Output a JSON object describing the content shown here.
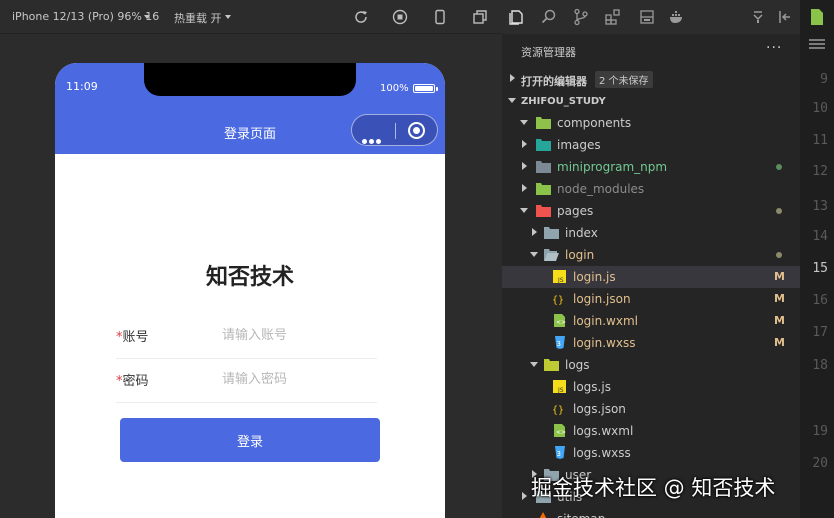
{
  "simulator": {
    "device_label": "iPhone 12/13 (Pro) 96% 16",
    "hot_reload_label": "热重载 开",
    "status": {
      "time": "11:09",
      "battery": "100%"
    },
    "nav_title": "登录页面",
    "page": {
      "heading": "知否技术",
      "username": {
        "required_mark": "*",
        "label": "账号",
        "placeholder": "请输入账号"
      },
      "password": {
        "required_mark": "*",
        "label": "密码",
        "placeholder": "请输入密码"
      },
      "login_button": "登录"
    },
    "colors": {
      "brand": "#4b69e0",
      "required": "#e03b3b"
    }
  },
  "explorer": {
    "title": "资源管理器",
    "more": "···",
    "open_editors": {
      "label": "打开的编辑器",
      "badge": "2 个未保存"
    },
    "project": "ZHIFOU_STUDY",
    "items": [
      {
        "label": "components",
        "status": ""
      },
      {
        "label": "images",
        "status": ""
      },
      {
        "label": "miniprogram_npm",
        "status": ""
      },
      {
        "label": "node_modules",
        "status": ""
      },
      {
        "label": "pages",
        "status": ""
      },
      {
        "label": "index",
        "status": ""
      },
      {
        "label": "login",
        "status": ""
      },
      {
        "label": "login.js",
        "status": "M"
      },
      {
        "label": "login.json",
        "status": "M"
      },
      {
        "label": "login.wxml",
        "status": "M"
      },
      {
        "label": "login.wxss",
        "status": "M"
      },
      {
        "label": "logs",
        "status": ""
      },
      {
        "label": "logs.js",
        "status": ""
      },
      {
        "label": "logs.json",
        "status": ""
      },
      {
        "label": "logs.wxml",
        "status": ""
      },
      {
        "label": "logs.wxss",
        "status": ""
      },
      {
        "label": "user",
        "status": ""
      },
      {
        "label": "utils",
        "status": ""
      },
      {
        "label": "sitemap",
        "status": ""
      }
    ]
  },
  "editor": {
    "line_numbers": [
      "9",
      "10",
      "11",
      "12",
      "13",
      "14",
      "15",
      "16",
      "17",
      "18",
      "19",
      "20"
    ],
    "current_line": "15"
  },
  "watermark": "掘金技术社区 @ 知否技术"
}
